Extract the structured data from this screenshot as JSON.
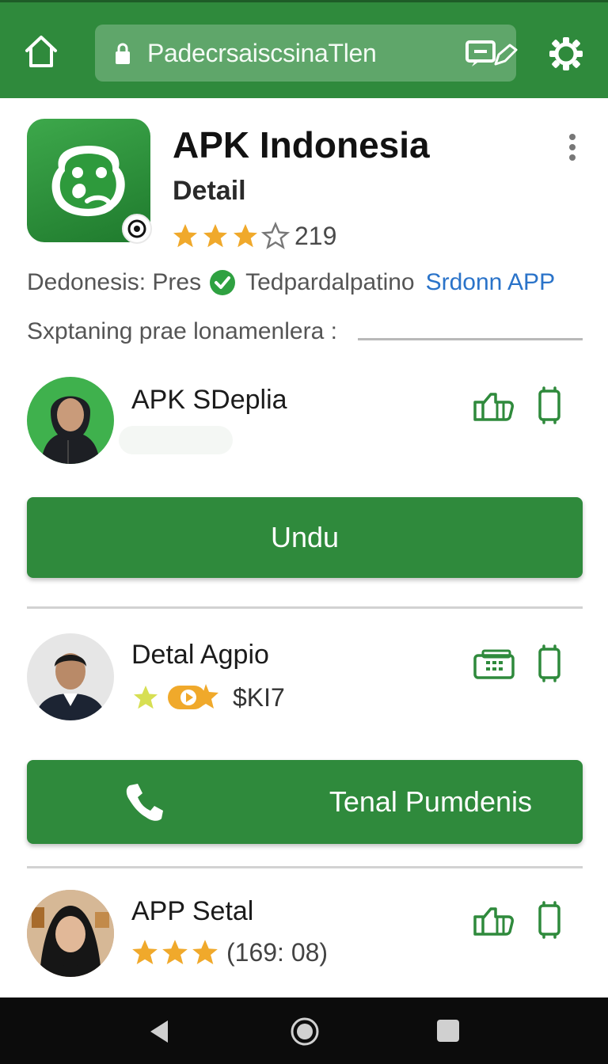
{
  "browser": {
    "url_text": "PadecrsaiscsinaTlen",
    "icons": [
      "home-icon",
      "lock-icon",
      "edit-icon",
      "tabs-icon",
      "settings-icon"
    ]
  },
  "app": {
    "title": "APK Indonesia",
    "subtitle": "Detail",
    "rating_stars": 3,
    "rating_max": 5,
    "rating_count": "219",
    "info_label": "Dedonesis: Pres",
    "info_status": "Tedpardalpatino",
    "info_link": "Srdonn APP",
    "section_label": "Sxptaning prae lonamenlera :"
  },
  "items": [
    {
      "title": "APK SDeplia",
      "button_label": "Undu"
    },
    {
      "title": "Detal Agpio",
      "meta": "$KI7",
      "button_label": "Tenal Pumdenis"
    },
    {
      "title": "APP Setal",
      "rating_stars": 3,
      "meta": "(169: 08)"
    }
  ],
  "colors": {
    "brand_green": "#2f8a3c",
    "star_gold": "#f0a92b",
    "link_blue": "#2a73c9"
  }
}
